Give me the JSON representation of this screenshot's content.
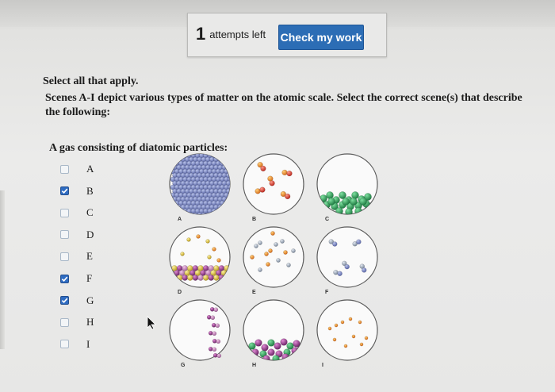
{
  "toolbar": {
    "attempts_number": "1",
    "attempts_text": "attempts left",
    "check_label": "Check my work"
  },
  "instruction": "Select all that apply.",
  "question": "Scenes A-I depict various types of matter on the atomic scale. Select the correct scene(s) that describe the following:",
  "prompt": "A gas consisting of diatomic particles:",
  "options": [
    {
      "label": "A",
      "checked": false
    },
    {
      "label": "B",
      "checked": true
    },
    {
      "label": "C",
      "checked": false
    },
    {
      "label": "D",
      "checked": false
    },
    {
      "label": "E",
      "checked": false
    },
    {
      "label": "F",
      "checked": true
    },
    {
      "label": "G",
      "checked": true
    },
    {
      "label": "H",
      "checked": false
    },
    {
      "label": "I",
      "checked": false
    }
  ],
  "scene_labels": [
    "A",
    "B",
    "C",
    "D",
    "E",
    "F",
    "G",
    "H",
    "I"
  ],
  "colors": {
    "check_button": "#2c6db5",
    "checkbox_checked": "#2f6cc2",
    "green": "#2e9d5a",
    "purple": "#9a3f8f",
    "yellow": "#d9c33a",
    "gray_atom": "#9aa7b8"
  }
}
